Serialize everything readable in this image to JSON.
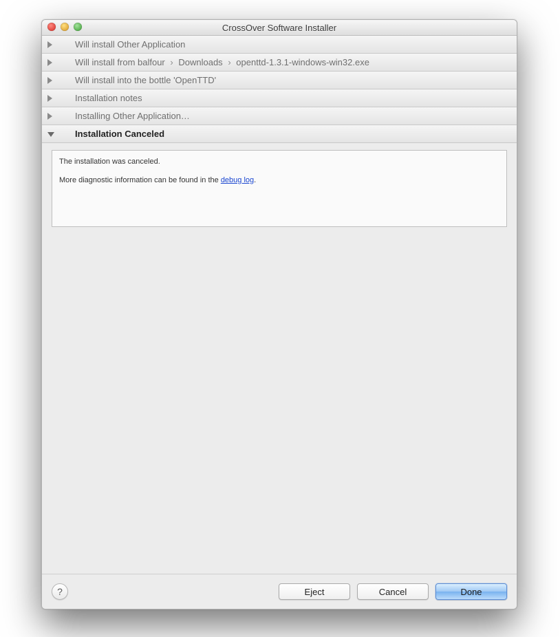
{
  "window": {
    "title": "CrossOver Software Installer"
  },
  "rows": {
    "r0": "Will install Other Application",
    "r1_prefix": "Will install from balfour",
    "r1_mid": "Downloads",
    "r1_file": "openttd-1.3.1-windows-win32.exe",
    "r2": "Will install into the bottle 'OpenTTD'",
    "r3": "Installation notes",
    "r4": "Installing Other Application…",
    "r5": "Installation Canceled"
  },
  "detail": {
    "line1": "The installation was canceled.",
    "line2_pre": "More diagnostic information can be found in the ",
    "line2_link": "debug log",
    "line2_post": "."
  },
  "footer": {
    "help": "?",
    "eject": "Eject",
    "cancel": "Cancel",
    "done": "Done"
  }
}
